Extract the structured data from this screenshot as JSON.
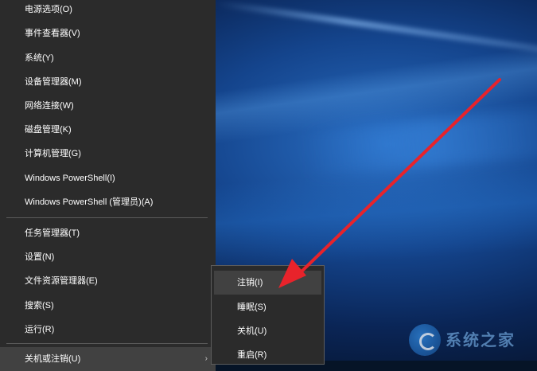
{
  "menu": {
    "items": [
      {
        "label": "电源选项(O)"
      },
      {
        "label": "事件查看器(V)"
      },
      {
        "label": "系统(Y)"
      },
      {
        "label": "设备管理器(M)"
      },
      {
        "label": "网络连接(W)"
      },
      {
        "label": "磁盘管理(K)"
      },
      {
        "label": "计算机管理(G)"
      },
      {
        "label": "Windows PowerShell(I)"
      },
      {
        "label": "Windows PowerShell (管理员)(A)"
      },
      {
        "label": "任务管理器(T)"
      },
      {
        "label": "设置(N)"
      },
      {
        "label": "文件资源管理器(E)"
      },
      {
        "label": "搜索(S)"
      },
      {
        "label": "运行(R)"
      },
      {
        "label": "关机或注销(U)"
      }
    ],
    "submenu_arrow": "›"
  },
  "submenu": {
    "items": [
      {
        "label": "注销(I)"
      },
      {
        "label": "睡眠(S)"
      },
      {
        "label": "关机(U)"
      },
      {
        "label": "重启(R)"
      }
    ]
  },
  "watermark": {
    "text": "系统之家"
  },
  "colors": {
    "menu_bg": "#2b2b2b",
    "hover_bg": "#414141",
    "arrow": "#e8232b"
  }
}
